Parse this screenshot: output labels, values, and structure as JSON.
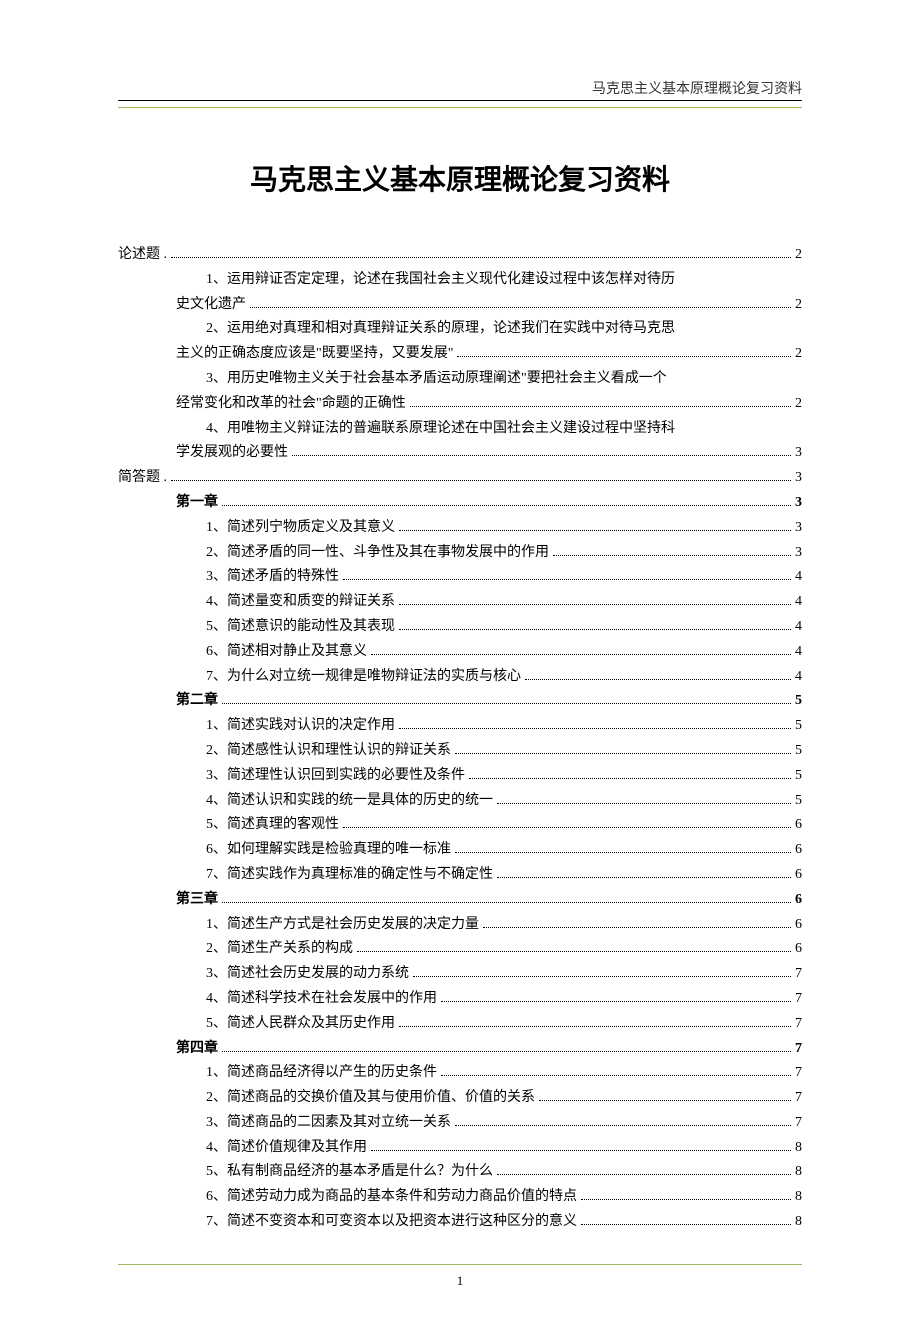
{
  "header": {
    "right": "马克思主义基本原理概论复习资料"
  },
  "title": "马克思主义基本原理概论复习资料",
  "toc": [
    {
      "lvl": 0,
      "text": "论述题 .",
      "page": "2",
      "bold": false
    },
    {
      "lvl": 2,
      "text": "1、运用辩证否定定理，论述在我国社会主义现代化建设过程中该怎样对待历",
      "page": "",
      "wrap": true
    },
    {
      "lvl": 1,
      "text": "史文化遗产",
      "page": "2"
    },
    {
      "lvl": 2,
      "text": "2、运用绝对真理和相对真理辩证关系的原理，论述我们在实践中对待马克思",
      "page": "",
      "wrap": true
    },
    {
      "lvl": 1,
      "text": "主义的正确态度应该是\"既要坚持，又要发展\"",
      "page": "2"
    },
    {
      "lvl": 2,
      "text": "3、用历史唯物主义关于社会基本矛盾运动原理阐述\"要把社会主义看成一个",
      "page": "",
      "wrap": true
    },
    {
      "lvl": 1,
      "text": "经常变化和改革的社会\"命题的正确性",
      "page": "2"
    },
    {
      "lvl": 2,
      "text": "4、用唯物主义辩证法的普遍联系原理论述在中国社会主义建设过程中坚持科",
      "page": "",
      "wrap": true
    },
    {
      "lvl": 1,
      "text": "学发展观的必要性",
      "page": "3"
    },
    {
      "lvl": 0,
      "text": "简答题 .",
      "page": "3"
    },
    {
      "lvl": 1,
      "text": "第一章",
      "page": "3",
      "bold": true
    },
    {
      "lvl": 2,
      "text": "1、简述列宁物质定义及其意义",
      "page": "3"
    },
    {
      "lvl": 2,
      "text": "2、简述矛盾的同一性、斗争性及其在事物发展中的作用",
      "page": "3"
    },
    {
      "lvl": 2,
      "text": "3、简述矛盾的特殊性",
      "page": "4"
    },
    {
      "lvl": 2,
      "text": "4、简述量变和质变的辩证关系",
      "page": "4"
    },
    {
      "lvl": 2,
      "text": "5、简述意识的能动性及其表现",
      "page": "4"
    },
    {
      "lvl": 2,
      "text": "6、简述相对静止及其意义",
      "page": "4"
    },
    {
      "lvl": 2,
      "text": "7、为什么对立统一规律是唯物辩证法的实质与核心",
      "page": "4"
    },
    {
      "lvl": 1,
      "text": "第二章",
      "page": "5",
      "bold": true
    },
    {
      "lvl": 2,
      "text": "1、简述实践对认识的决定作用",
      "page": "5"
    },
    {
      "lvl": 2,
      "text": "2、简述感性认识和理性认识的辩证关系",
      "page": "5"
    },
    {
      "lvl": 2,
      "text": "3、简述理性认识回到实践的必要性及条件",
      "page": "5"
    },
    {
      "lvl": 2,
      "text": "4、简述认识和实践的统一是具体的历史的统一",
      "page": "5"
    },
    {
      "lvl": 2,
      "text": "5、简述真理的客观性",
      "page": "6"
    },
    {
      "lvl": 2,
      "text": "6、如何理解实践是检验真理的唯一标准",
      "page": "6"
    },
    {
      "lvl": 2,
      "text": "7、简述实践作为真理标准的确定性与不确定性",
      "page": "6"
    },
    {
      "lvl": 1,
      "text": "第三章",
      "page": "6",
      "bold": true
    },
    {
      "lvl": 2,
      "text": "1、简述生产方式是社会历史发展的决定力量",
      "page": "6"
    },
    {
      "lvl": 2,
      "text": "2、简述生产关系的构成",
      "page": "6"
    },
    {
      "lvl": 2,
      "text": "3、简述社会历史发展的动力系统",
      "page": "7"
    },
    {
      "lvl": 2,
      "text": "4、简述科学技术在社会发展中的作用",
      "page": "7"
    },
    {
      "lvl": 2,
      "text": "5、简述人民群众及其历史作用",
      "page": "7"
    },
    {
      "lvl": 1,
      "text": "第四章",
      "page": "7",
      "bold": true
    },
    {
      "lvl": 2,
      "text": "1、简述商品经济得以产生的历史条件",
      "page": "7"
    },
    {
      "lvl": 2,
      "text": "2、简述商品的交换价值及其与使用价值、价值的关系",
      "page": "7"
    },
    {
      "lvl": 2,
      "text": "3、简述商品的二因素及其对立统一关系",
      "page": "7"
    },
    {
      "lvl": 2,
      "text": "4、简述价值规律及其作用",
      "page": "8"
    },
    {
      "lvl": 2,
      "text": "5、私有制商品经济的基本矛盾是什么？为什么",
      "page": "8"
    },
    {
      "lvl": 2,
      "text": "6、简述劳动力成为商品的基本条件和劳动力商品价值的特点",
      "page": "8"
    },
    {
      "lvl": 2,
      "text": "7、简述不变资本和可变资本以及把资本进行这种区分的意义",
      "page": "8"
    }
  ],
  "footer": {
    "page_number": "1"
  }
}
